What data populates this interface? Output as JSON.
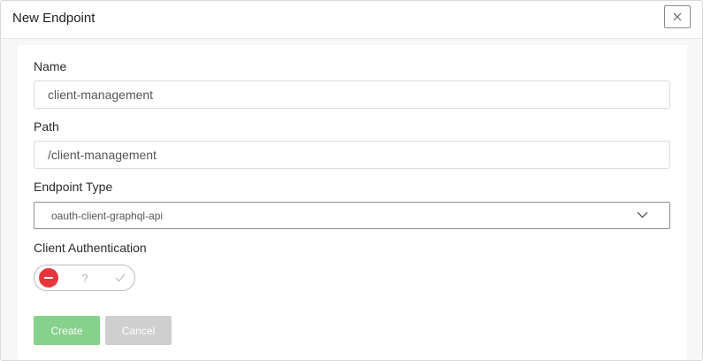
{
  "dialog": {
    "title": "New Endpoint"
  },
  "form": {
    "name": {
      "label": "Name",
      "value": "client-management"
    },
    "path": {
      "label": "Path",
      "value": "/client-management"
    },
    "endpoint_type": {
      "label": "Endpoint Type",
      "selected": "oauth-client-graphql-api"
    },
    "client_authentication": {
      "label": "Client Authentication",
      "state": "off",
      "unknown_glyph": "?"
    }
  },
  "actions": {
    "create_label": "Create",
    "cancel_label": "Cancel"
  },
  "colors": {
    "create_button": "#86d18b",
    "cancel_button": "#cfcfcf",
    "toggle_off": "#e8353b"
  },
  "icons": {
    "close": "close-icon",
    "chevron": "chevron-down-icon",
    "toggle_off": "minus-icon",
    "toggle_on": "check-icon"
  }
}
